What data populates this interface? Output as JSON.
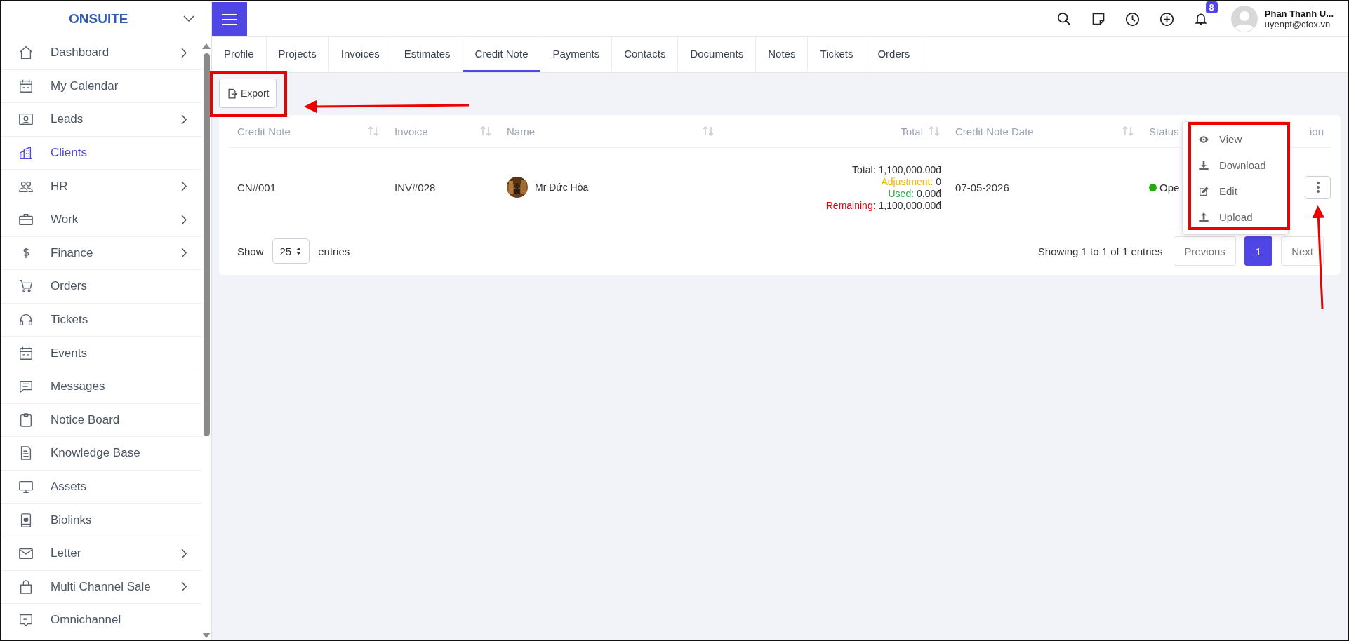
{
  "sidebar": {
    "brand": "ONSUITE",
    "items": [
      {
        "label": "Dashboard",
        "selected": false,
        "expandable": true
      },
      {
        "label": "My Calendar",
        "selected": false,
        "expandable": false
      },
      {
        "label": "Leads",
        "selected": false,
        "expandable": true
      },
      {
        "label": "Clients",
        "selected": true,
        "expandable": false
      },
      {
        "label": "HR",
        "selected": false,
        "expandable": true
      },
      {
        "label": "Work",
        "selected": false,
        "expandable": true
      },
      {
        "label": "Finance",
        "selected": false,
        "expandable": true
      },
      {
        "label": "Orders",
        "selected": false,
        "expandable": false
      },
      {
        "label": "Tickets",
        "selected": false,
        "expandable": false
      },
      {
        "label": "Events",
        "selected": false,
        "expandable": false
      },
      {
        "label": "Messages",
        "selected": false,
        "expandable": false
      },
      {
        "label": "Notice Board",
        "selected": false,
        "expandable": false
      },
      {
        "label": "Knowledge Base",
        "selected": false,
        "expandable": false
      },
      {
        "label": "Assets",
        "selected": false,
        "expandable": false
      },
      {
        "label": "Biolinks",
        "selected": false,
        "expandable": false
      },
      {
        "label": "Letter",
        "selected": false,
        "expandable": true
      },
      {
        "label": "Multi Channel Sale",
        "selected": false,
        "expandable": true
      },
      {
        "label": "Omnichannel",
        "selected": false,
        "expandable": false
      }
    ]
  },
  "topbar": {
    "notification_count": "8",
    "user": {
      "name": "Phan Thanh U...",
      "email": "uyenpt@cfox.vn"
    }
  },
  "tabs": [
    {
      "label": "Profile",
      "selected": false
    },
    {
      "label": "Projects",
      "selected": false
    },
    {
      "label": "Invoices",
      "selected": false
    },
    {
      "label": "Estimates",
      "selected": false
    },
    {
      "label": "Credit Note",
      "selected": true
    },
    {
      "label": "Payments",
      "selected": false
    },
    {
      "label": "Contacts",
      "selected": false
    },
    {
      "label": "Documents",
      "selected": false
    },
    {
      "label": "Notes",
      "selected": false
    },
    {
      "label": "Tickets",
      "selected": false
    },
    {
      "label": "Orders",
      "selected": false
    }
  ],
  "toolbar": {
    "export_label": "Export"
  },
  "table": {
    "columns": [
      {
        "label": "Credit Note",
        "sortable": true
      },
      {
        "label": "Invoice",
        "sortable": true
      },
      {
        "label": "Name",
        "sortable": true
      },
      {
        "label": "Total",
        "sortable": true
      },
      {
        "label": "Credit Note Date",
        "sortable": true
      },
      {
        "label": "Status",
        "sortable": false
      },
      {
        "label": "ion",
        "sortable": false
      }
    ],
    "rows": [
      {
        "credit_note": "CN#001",
        "invoice": "INV#028",
        "name": "Mr Đức Hòa",
        "date": "07-05-2026",
        "status": {
          "label": "Ope",
          "color": "#22aa11"
        },
        "totals": [
          {
            "kind": "total",
            "label": "Total:",
            "value": "1,100,000.00đ"
          },
          {
            "kind": "adjustment",
            "label": "Adjustment:",
            "value": "0"
          },
          {
            "kind": "used",
            "label": "Used:",
            "value": "0.00đ"
          },
          {
            "kind": "remaining",
            "label": "Remaining:",
            "value": "1,100,000.00đ"
          }
        ]
      }
    ]
  },
  "footer": {
    "show_label": "Show",
    "page_size": "25",
    "entries_label": "entries",
    "info": "Showing 1 to 1 of 1 entries",
    "previous": "Previous",
    "pages": [
      {
        "label": "1",
        "selected": true
      }
    ],
    "next": "Next"
  },
  "action_menu": {
    "items": [
      {
        "label": "View"
      },
      {
        "label": "Download"
      },
      {
        "label": "Edit"
      },
      {
        "label": "Upload"
      }
    ]
  }
}
